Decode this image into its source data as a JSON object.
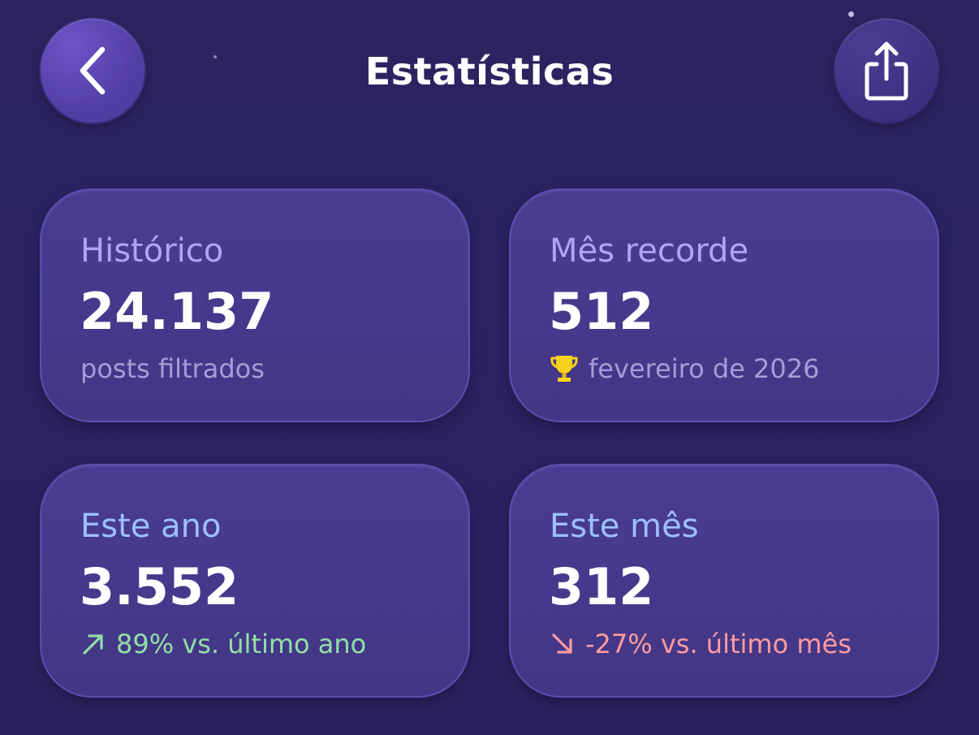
{
  "header": {
    "title": "Estatísticas",
    "back_icon": "chevron-left-icon",
    "share_icon": "share-icon"
  },
  "colors": {
    "purple_label": "#b3a3f5",
    "blue_label": "#9cc0ff",
    "muted_sub": "#a79cd8",
    "positive": "#92e0a6",
    "negative": "#ff9ba0",
    "trophy": "#f6d21a"
  },
  "cards": [
    {
      "label": "Histórico",
      "value": "24.137",
      "sub": "posts filtrados"
    },
    {
      "label": "Mês recorde",
      "value": "512",
      "sub": "fevereiro de 2026",
      "icon": "trophy-icon"
    },
    {
      "label": "Este ano",
      "value": "3.552",
      "sub": "89% vs. último ano",
      "icon": "arrow-up-right-icon"
    },
    {
      "label": "Este mês",
      "value": "312",
      "sub": "-27% vs. último mês",
      "icon": "arrow-down-right-icon"
    }
  ]
}
